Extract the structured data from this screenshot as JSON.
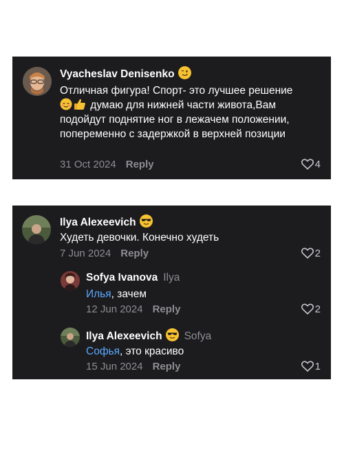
{
  "comments": [
    {
      "author": "Vyacheslav Denisenko",
      "author_emoji": "winking-face-emoji",
      "text_line1": "Отличная фигура! Спорт- это лучшее решение",
      "text_rest": " думаю  для нижней части живота,Вам подойдут  поднятие ног в лежачем положении,  попеременно с задержкой в верхней позиции",
      "inline_emojis": [
        "relieved-face-emoji",
        "thumbs-up-emoji"
      ],
      "date": "31 Oct 2024",
      "reply_label": "Reply",
      "likes": "4"
    },
    {
      "author": "Ilya Alexeevich",
      "author_emoji": "sunglasses-face-emoji",
      "text": "Худеть девочки. Конечно худеть",
      "date": "7 Jun 2024",
      "reply_label": "Reply",
      "likes": "2"
    },
    {
      "author": "Sofya Ivanova",
      "reply_to": "Ilya",
      "mention": "Илья",
      "text": ", зачем",
      "date": "12 Jun 2024",
      "reply_label": "Reply",
      "likes": "2"
    },
    {
      "author": "Ilya Alexeevich",
      "author_emoji": "sunglasses-face-emoji",
      "reply_to": "Sofya",
      "mention": "Софья",
      "text": ", это красиво",
      "date": "15 Jun 2024",
      "reply_label": "Reply",
      "likes": "1"
    }
  ],
  "colors": {
    "background": "#1c1c1e",
    "text": "#ffffff",
    "muted": "#8e8e93",
    "mention": "#5aa9ff",
    "emoji": "#f7c232"
  }
}
